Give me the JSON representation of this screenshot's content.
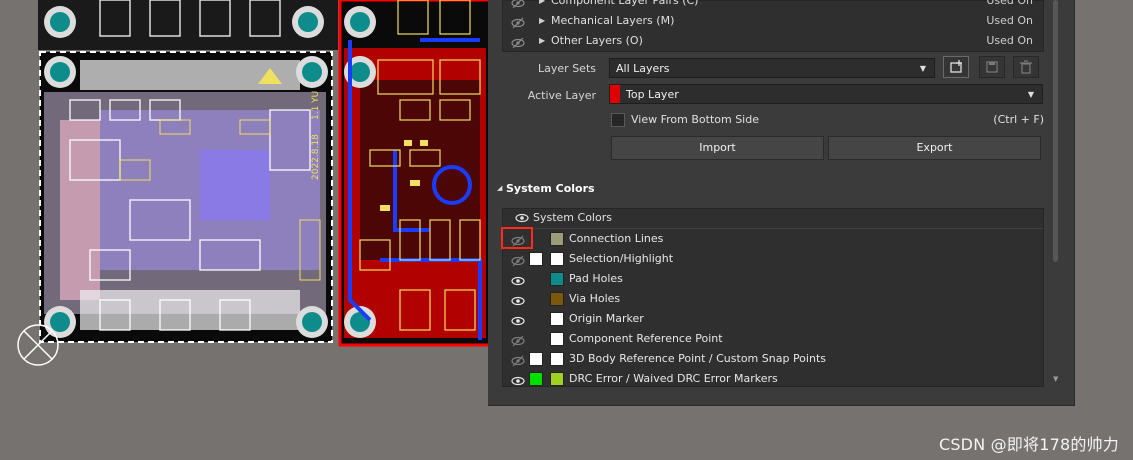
{
  "layers_panel": {
    "layer_groups": [
      {
        "label": "Component Layer Pairs (C)",
        "status": "Used On",
        "visible": true
      },
      {
        "label": "Mechanical Layers (M)",
        "status": "Used On",
        "visible": false
      },
      {
        "label": "Other Layers (O)",
        "status": "Used On",
        "visible": false
      }
    ],
    "layer_sets": {
      "label": "Layer Sets",
      "value": "All Layers"
    },
    "active_layer": {
      "label": "Active Layer",
      "value": "Top Layer",
      "color": "#e00000"
    },
    "view_from_bottom": {
      "label": "View From Bottom Side",
      "shortcut": "(Ctrl + F)",
      "checked": false
    },
    "buttons": {
      "import": "Import",
      "export": "Export"
    }
  },
  "system_colors": {
    "section_title": "System Colors",
    "table_header": "System Colors",
    "rows": [
      {
        "label": "Connection Lines",
        "visible": false,
        "swatch1": null,
        "swatch2": "#9c9c7a",
        "highlighted": true
      },
      {
        "label": "Selection/Highlight",
        "visible": false,
        "swatch1": "#ffffff",
        "swatch2": "#ffffff"
      },
      {
        "label": "Pad Holes",
        "visible": true,
        "swatch1": null,
        "swatch2": "#0e8c8c"
      },
      {
        "label": "Via Holes",
        "visible": true,
        "swatch1": null,
        "swatch2": "#7a5a0a"
      },
      {
        "label": "Origin Marker",
        "visible": true,
        "swatch1": null,
        "swatch2": "#ffffff"
      },
      {
        "label": "Component Reference Point",
        "visible": false,
        "swatch1": null,
        "swatch2": "#ffffff"
      },
      {
        "label": "3D Body Reference Point / Custom Snap Points",
        "visible": false,
        "swatch1": "#ffffff",
        "swatch2": "#ffffff"
      },
      {
        "label": "DRC Error / Waived DRC Error Markers",
        "visible": true,
        "swatch1": "#00e000",
        "swatch2": "#a0d020"
      }
    ]
  },
  "pcb": {
    "silkscreen_text": "2022.8.18 / 1.1 YU"
  },
  "watermark": "CSDN @即将178的帅力",
  "colors": {
    "annotation_red": "#ff2a1a",
    "panel_bg": "#3b3b3b",
    "board_red": "#e00000",
    "board_blue": "#1a3cff"
  }
}
